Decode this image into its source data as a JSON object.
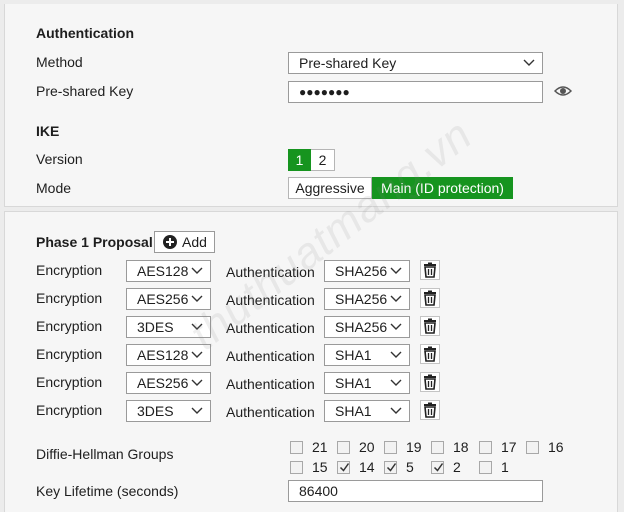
{
  "auth": {
    "heading": "Authentication",
    "method_label": "Method",
    "method_value": "Pre-shared Key",
    "psk_label": "Pre-shared Key",
    "psk_value": "●●●●●●●"
  },
  "ike": {
    "heading": "IKE",
    "version_label": "Version",
    "version_options": [
      "1",
      "2"
    ],
    "version_selected": "1",
    "mode_label": "Mode",
    "mode_options": [
      "Aggressive",
      "Main (ID protection)"
    ],
    "mode_selected": "Main (ID protection)"
  },
  "phase1": {
    "heading": "Phase 1 Proposal",
    "add_label": "Add",
    "enc_label": "Encryption",
    "auth_label": "Authentication",
    "proposals": [
      {
        "encryption": "AES128",
        "authentication": "SHA256"
      },
      {
        "encryption": "AES256",
        "authentication": "SHA256"
      },
      {
        "encryption": "3DES",
        "authentication": "SHA256"
      },
      {
        "encryption": "AES128",
        "authentication": "SHA1"
      },
      {
        "encryption": "AES256",
        "authentication": "SHA1"
      },
      {
        "encryption": "3DES",
        "authentication": "SHA1"
      }
    ]
  },
  "dh": {
    "label": "Diffie-Hellman Groups",
    "groups": [
      {
        "id": "21",
        "checked": false
      },
      {
        "id": "20",
        "checked": false
      },
      {
        "id": "19",
        "checked": false
      },
      {
        "id": "18",
        "checked": false
      },
      {
        "id": "17",
        "checked": false
      },
      {
        "id": "16",
        "checked": false
      },
      {
        "id": "15",
        "checked": false
      },
      {
        "id": "14",
        "checked": true
      },
      {
        "id": "5",
        "checked": true
      },
      {
        "id": "2",
        "checked": true
      },
      {
        "id": "1",
        "checked": false
      }
    ]
  },
  "lifetime": {
    "label": "Key Lifetime (seconds)",
    "value": "86400"
  },
  "watermark": "thuthuatmang.vn",
  "colors": {
    "accent_green": "#16941f",
    "panel_bg": "#f6f6f6",
    "page_bg": "#ececec"
  }
}
